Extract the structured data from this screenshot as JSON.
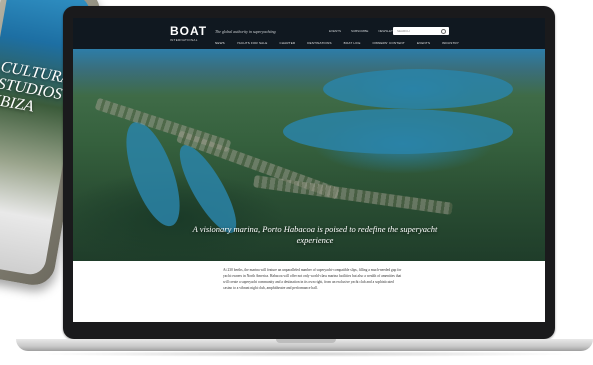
{
  "phone": {
    "overlay_text": "CULTURAL\nSTUDIOS\nIBIZA"
  },
  "nav": {
    "logo": "BOAT",
    "logo_sub": "INTERNATIONAL",
    "tagline": "The global authority in superyachting",
    "top_links": [
      "EVENTS",
      "SUBSCRIBE",
      "NEWSLETTERS"
    ],
    "search_placeholder": "SEARCH",
    "menu": [
      "NEWS",
      "YACHTS FOR SALE",
      "CHARTER",
      "DESTINATIONS",
      "BOAT LIFE",
      "OWNERS' CONTENT",
      "EVENTS",
      "INDUSTRY"
    ]
  },
  "hero": {
    "caption": "A visionary marina, Porto Habacoa is poised to redefine the superyacht experience"
  },
  "article": {
    "body": "At 230 berths, the marina will feature an unparalleled number of superyacht-compatible slips, filling a much-needed gap for yacht owners in North America. Habacoa will offer not only world-class marina facilities but also a wealth of amenities that will create a superyacht community and a destination in its own right, from an exclusive yacht club and a sophisticated casino to a vibrant night club, amphitheatre and performance hall."
  }
}
